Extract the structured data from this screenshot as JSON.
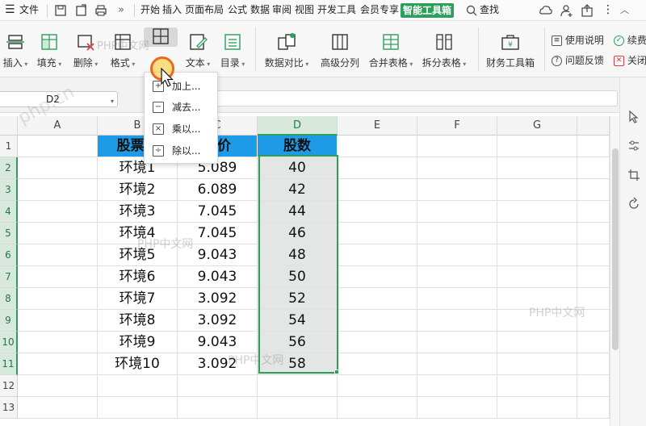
{
  "menubar": {
    "file_label": "文件",
    "tabs": [
      "开始",
      "插入",
      "页面布局",
      "公式",
      "数据",
      "审阅",
      "视图",
      "开发工具",
      "会员专享"
    ],
    "smart_tab": "智能工具箱",
    "search_label": "查找",
    "more_glyph": "»"
  },
  "ribbon": {
    "insert": "插入",
    "fill": "填充",
    "delete": "删除",
    "format": "格式",
    "text": "文本",
    "toc": "目录",
    "compare": "数据对比",
    "split_adv": "高级分列",
    "merge_table": "合并表格",
    "split_table": "拆分表格",
    "finance": "财务工具箱",
    "help": "使用说明",
    "feedback": "问题反馈",
    "continue": "续费",
    "close": "关闭"
  },
  "formula_bar": {
    "cell_ref": "D2"
  },
  "dropdown": {
    "items": [
      {
        "label": "加上...",
        "icon": "+"
      },
      {
        "label": "减去...",
        "icon": "−"
      },
      {
        "label": "乘以...",
        "icon": "×"
      },
      {
        "label": "除以...",
        "icon": "÷"
      }
    ]
  },
  "sheet": {
    "columns": [
      "A",
      "B",
      "C",
      "D",
      "E",
      "F",
      "G"
    ],
    "rows": [
      "1",
      "2",
      "3",
      "4",
      "5",
      "6",
      "7",
      "8",
      "9",
      "10",
      "11",
      "12",
      "13"
    ],
    "header_row": [
      "股票名",
      "成本价",
      "股数"
    ],
    "header_visible": [
      "股票名",
      "本价",
      "股数"
    ],
    "data": [
      [
        "环境1",
        "5.089",
        "40"
      ],
      [
        "环境2",
        "6.089",
        "42"
      ],
      [
        "环境3",
        "7.045",
        "44"
      ],
      [
        "环境4",
        "7.045",
        "46"
      ],
      [
        "环境5",
        "9.043",
        "48"
      ],
      [
        "环境6",
        "9.043",
        "50"
      ],
      [
        "环境7",
        "3.092",
        "52"
      ],
      [
        "环境8",
        "3.092",
        "54"
      ],
      [
        "环境9",
        "9.043",
        "56"
      ],
      [
        "环境10",
        "3.092",
        "58"
      ]
    ],
    "header_color": "#1e9be6",
    "selection_color": "#2e9e5b"
  },
  "watermarks": [
    "php.cn",
    "PHP中文网",
    "PHP中文网",
    "PHP中文网",
    "PHP中文网"
  ]
}
